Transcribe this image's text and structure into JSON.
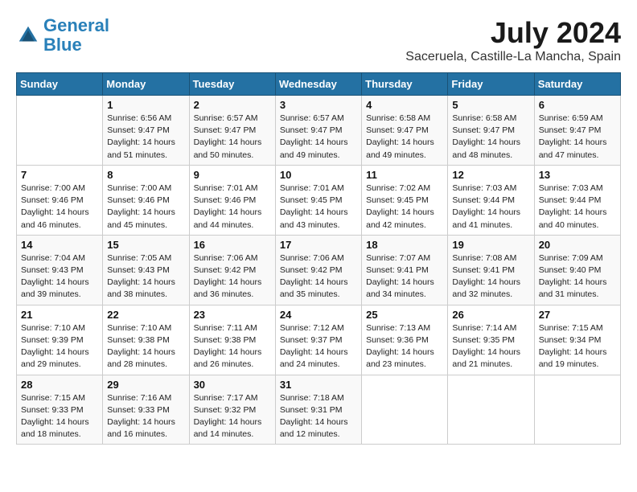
{
  "header": {
    "logo_line1": "General",
    "logo_line2": "Blue",
    "title": "July 2024",
    "subtitle": "Saceruela, Castille-La Mancha, Spain"
  },
  "calendar": {
    "days_of_week": [
      "Sunday",
      "Monday",
      "Tuesday",
      "Wednesday",
      "Thursday",
      "Friday",
      "Saturday"
    ],
    "weeks": [
      [
        {
          "day": "",
          "info": ""
        },
        {
          "day": "1",
          "info": "Sunrise: 6:56 AM\nSunset: 9:47 PM\nDaylight: 14 hours\nand 51 minutes."
        },
        {
          "day": "2",
          "info": "Sunrise: 6:57 AM\nSunset: 9:47 PM\nDaylight: 14 hours\nand 50 minutes."
        },
        {
          "day": "3",
          "info": "Sunrise: 6:57 AM\nSunset: 9:47 PM\nDaylight: 14 hours\nand 49 minutes."
        },
        {
          "day": "4",
          "info": "Sunrise: 6:58 AM\nSunset: 9:47 PM\nDaylight: 14 hours\nand 49 minutes."
        },
        {
          "day": "5",
          "info": "Sunrise: 6:58 AM\nSunset: 9:47 PM\nDaylight: 14 hours\nand 48 minutes."
        },
        {
          "day": "6",
          "info": "Sunrise: 6:59 AM\nSunset: 9:47 PM\nDaylight: 14 hours\nand 47 minutes."
        }
      ],
      [
        {
          "day": "7",
          "info": "Sunrise: 7:00 AM\nSunset: 9:46 PM\nDaylight: 14 hours\nand 46 minutes."
        },
        {
          "day": "8",
          "info": "Sunrise: 7:00 AM\nSunset: 9:46 PM\nDaylight: 14 hours\nand 45 minutes."
        },
        {
          "day": "9",
          "info": "Sunrise: 7:01 AM\nSunset: 9:46 PM\nDaylight: 14 hours\nand 44 minutes."
        },
        {
          "day": "10",
          "info": "Sunrise: 7:01 AM\nSunset: 9:45 PM\nDaylight: 14 hours\nand 43 minutes."
        },
        {
          "day": "11",
          "info": "Sunrise: 7:02 AM\nSunset: 9:45 PM\nDaylight: 14 hours\nand 42 minutes."
        },
        {
          "day": "12",
          "info": "Sunrise: 7:03 AM\nSunset: 9:44 PM\nDaylight: 14 hours\nand 41 minutes."
        },
        {
          "day": "13",
          "info": "Sunrise: 7:03 AM\nSunset: 9:44 PM\nDaylight: 14 hours\nand 40 minutes."
        }
      ],
      [
        {
          "day": "14",
          "info": "Sunrise: 7:04 AM\nSunset: 9:43 PM\nDaylight: 14 hours\nand 39 minutes."
        },
        {
          "day": "15",
          "info": "Sunrise: 7:05 AM\nSunset: 9:43 PM\nDaylight: 14 hours\nand 38 minutes."
        },
        {
          "day": "16",
          "info": "Sunrise: 7:06 AM\nSunset: 9:42 PM\nDaylight: 14 hours\nand 36 minutes."
        },
        {
          "day": "17",
          "info": "Sunrise: 7:06 AM\nSunset: 9:42 PM\nDaylight: 14 hours\nand 35 minutes."
        },
        {
          "day": "18",
          "info": "Sunrise: 7:07 AM\nSunset: 9:41 PM\nDaylight: 14 hours\nand 34 minutes."
        },
        {
          "day": "19",
          "info": "Sunrise: 7:08 AM\nSunset: 9:41 PM\nDaylight: 14 hours\nand 32 minutes."
        },
        {
          "day": "20",
          "info": "Sunrise: 7:09 AM\nSunset: 9:40 PM\nDaylight: 14 hours\nand 31 minutes."
        }
      ],
      [
        {
          "day": "21",
          "info": "Sunrise: 7:10 AM\nSunset: 9:39 PM\nDaylight: 14 hours\nand 29 minutes."
        },
        {
          "day": "22",
          "info": "Sunrise: 7:10 AM\nSunset: 9:38 PM\nDaylight: 14 hours\nand 28 minutes."
        },
        {
          "day": "23",
          "info": "Sunrise: 7:11 AM\nSunset: 9:38 PM\nDaylight: 14 hours\nand 26 minutes."
        },
        {
          "day": "24",
          "info": "Sunrise: 7:12 AM\nSunset: 9:37 PM\nDaylight: 14 hours\nand 24 minutes."
        },
        {
          "day": "25",
          "info": "Sunrise: 7:13 AM\nSunset: 9:36 PM\nDaylight: 14 hours\nand 23 minutes."
        },
        {
          "day": "26",
          "info": "Sunrise: 7:14 AM\nSunset: 9:35 PM\nDaylight: 14 hours\nand 21 minutes."
        },
        {
          "day": "27",
          "info": "Sunrise: 7:15 AM\nSunset: 9:34 PM\nDaylight: 14 hours\nand 19 minutes."
        }
      ],
      [
        {
          "day": "28",
          "info": "Sunrise: 7:15 AM\nSunset: 9:33 PM\nDaylight: 14 hours\nand 18 minutes."
        },
        {
          "day": "29",
          "info": "Sunrise: 7:16 AM\nSunset: 9:33 PM\nDaylight: 14 hours\nand 16 minutes."
        },
        {
          "day": "30",
          "info": "Sunrise: 7:17 AM\nSunset: 9:32 PM\nDaylight: 14 hours\nand 14 minutes."
        },
        {
          "day": "31",
          "info": "Sunrise: 7:18 AM\nSunset: 9:31 PM\nDaylight: 14 hours\nand 12 minutes."
        },
        {
          "day": "",
          "info": ""
        },
        {
          "day": "",
          "info": ""
        },
        {
          "day": "",
          "info": ""
        }
      ]
    ]
  }
}
